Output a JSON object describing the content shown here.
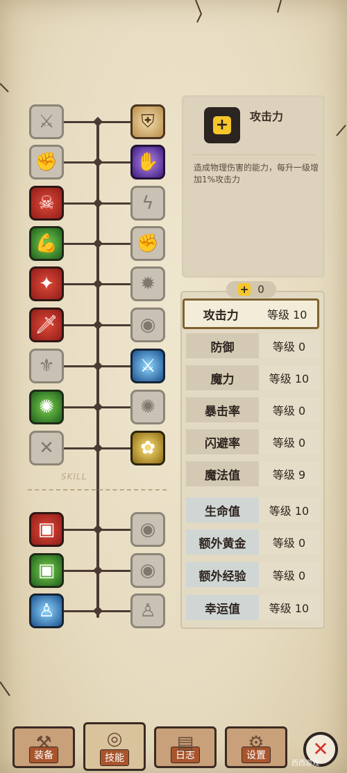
{
  "skills": {
    "left": [
      {
        "icon": "sword-slash-icon",
        "glyph": "⚔",
        "state": "locked"
      },
      {
        "icon": "muscle-figure-icon",
        "glyph": "✊",
        "state": "locked"
      },
      {
        "icon": "rage-face-icon",
        "glyph": "☠",
        "state": "red"
      },
      {
        "icon": "flex-arm-icon",
        "glyph": "💪",
        "state": "green"
      },
      {
        "icon": "dark-figure-icon",
        "glyph": "✦",
        "state": "red"
      },
      {
        "icon": "dagger-icon",
        "glyph": "🗡",
        "state": "red"
      },
      {
        "icon": "shadow-hero-icon",
        "glyph": "⚜",
        "state": "locked"
      },
      {
        "icon": "golden-beast-icon",
        "glyph": "✺",
        "state": "green"
      },
      {
        "icon": "crossed-blades-icon",
        "glyph": "✕",
        "state": "locked"
      },
      {
        "icon": "chest-red-icon",
        "glyph": "▣",
        "state": "red"
      },
      {
        "icon": "chest-green-icon",
        "glyph": "▣",
        "state": "green"
      },
      {
        "icon": "spirit-blue-icon",
        "glyph": "♙",
        "state": "blue"
      }
    ],
    "right": [
      {
        "icon": "shield-emblem-icon",
        "glyph": "⛨",
        "state": "gold"
      },
      {
        "icon": "purple-claw-icon",
        "glyph": "✋",
        "state": "purple"
      },
      {
        "icon": "lightning-figure-icon",
        "glyph": "ϟ",
        "state": "locked"
      },
      {
        "icon": "fist-punch-icon",
        "glyph": "✊",
        "state": "locked"
      },
      {
        "icon": "burst-figure-icon",
        "glyph": "✹",
        "state": "locked"
      },
      {
        "icon": "eye-orb-icon",
        "glyph": "◉",
        "state": "locked"
      },
      {
        "icon": "blue-sword-icon",
        "glyph": "⚔",
        "state": "blue"
      },
      {
        "icon": "swirl-icon",
        "glyph": "✺",
        "state": "locked"
      },
      {
        "icon": "green-spirit-icon",
        "glyph": "✿",
        "state": "yellow"
      },
      {
        "icon": "eye-chest-icon",
        "glyph": "◉",
        "state": "locked"
      },
      {
        "icon": "eye-chest-icon",
        "glyph": "◉",
        "state": "locked"
      },
      {
        "icon": "ghost-figure-icon",
        "glyph": "♙",
        "state": "locked"
      }
    ]
  },
  "section_label": "SKILL",
  "info": {
    "title": "攻击力",
    "icon": "plus-icon",
    "description": "造成物理伤害的能力，每升一级增加1%攻击力"
  },
  "points": {
    "value": "0"
  },
  "stats": [
    {
      "name": "攻击力",
      "level": "等级 10",
      "selected": true
    },
    {
      "name": "防御",
      "level": "等级 0"
    },
    {
      "name": "魔力",
      "level": "等级 10"
    },
    {
      "name": "暴击率",
      "level": "等级 0"
    },
    {
      "name": "闪避率",
      "level": "等级 0"
    },
    {
      "name": "魔法值",
      "level": "等级 9"
    },
    {
      "name": "生命值",
      "level": "等级 10"
    },
    {
      "name": "额外黄金",
      "level": "等级 0"
    },
    {
      "name": "额外经验",
      "level": "等级 0"
    },
    {
      "name": "幸运值",
      "level": "等级 10"
    }
  ],
  "nav": [
    {
      "label": "装备",
      "icon": "equipment-icon",
      "glyph": "⚒"
    },
    {
      "label": "技能",
      "icon": "skill-icon",
      "glyph": "◎",
      "active": true
    },
    {
      "label": "日志",
      "icon": "journal-icon",
      "glyph": "▤"
    },
    {
      "label": "设置",
      "icon": "settings-icon",
      "glyph": "⚙"
    }
  ],
  "close_label": "✕",
  "watermark": "西西游戏"
}
